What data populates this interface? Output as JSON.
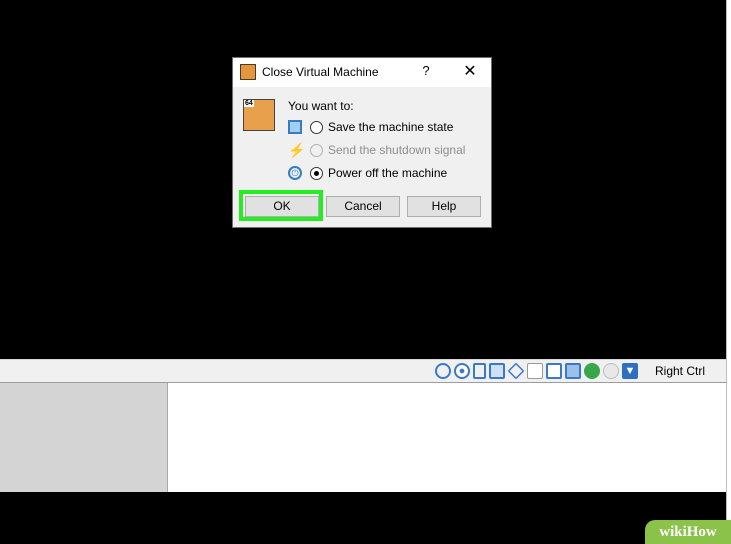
{
  "dialog": {
    "title": "Close Virtual Machine",
    "help_label": "?",
    "close_label": "✕",
    "badge": "64",
    "prompt": "You want to:",
    "options": [
      {
        "label": "Save the machine state",
        "checked": false,
        "disabled": false,
        "icon": "save-state-icon"
      },
      {
        "label": "Send the shutdown signal",
        "checked": false,
        "disabled": true,
        "icon": "shutdown-signal-icon"
      },
      {
        "label": "Power off the machine",
        "checked": true,
        "disabled": false,
        "icon": "power-off-icon"
      }
    ],
    "buttons": {
      "ok": "OK",
      "cancel": "Cancel",
      "help": "Help"
    }
  },
  "statusbar": {
    "host_key": "Right Ctrl",
    "icons": [
      "hard-disk-icon",
      "optical-drive-icon",
      "audio-icon",
      "network-icon",
      "usb-icon",
      "shared-folders-icon",
      "display-icon",
      "video-capture-icon",
      "mouse-integration-icon",
      "cpu-icon",
      "arrow-down-icon"
    ]
  },
  "watermark": {
    "text": "wikiHow"
  },
  "colors": {
    "highlight": "#22ee22",
    "vm_screen": "#000000",
    "dialog_bg": "#f0f0f0",
    "status_icon": "#3a78c8",
    "watermark_bg": "#8bc34a"
  }
}
